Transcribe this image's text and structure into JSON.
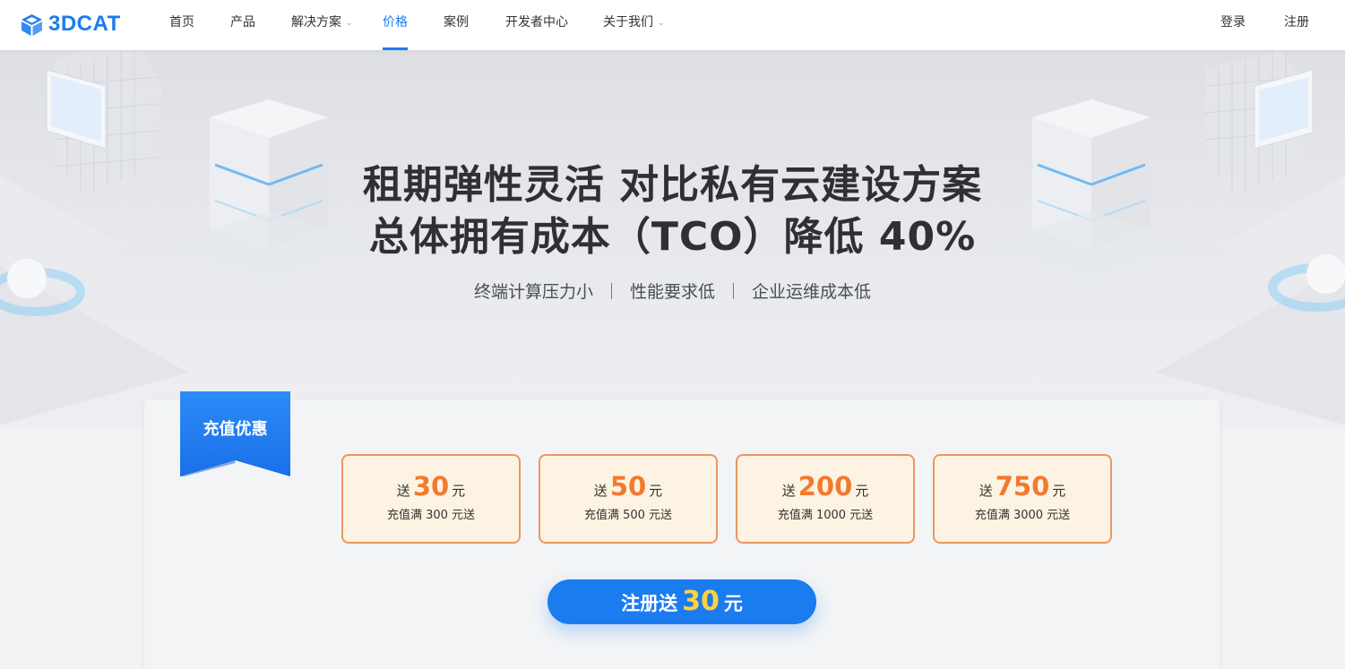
{
  "brand": {
    "name": "3DCAT"
  },
  "nav": {
    "items": [
      {
        "label": "首页"
      },
      {
        "label": "产品"
      },
      {
        "label": "解决方案"
      },
      {
        "label": "价格"
      },
      {
        "label": "案例"
      },
      {
        "label": "开发者中心"
      },
      {
        "label": "关于我们"
      }
    ],
    "active": "价格",
    "login": "登录",
    "register": "注册"
  },
  "hero": {
    "title_line1": "租期弹性灵活 对比私有云建设方案",
    "title_line2": "总体拥有成本（TCO）降低 40%",
    "features": [
      "终端计算压力小",
      "性能要求低",
      "企业运维成本低"
    ]
  },
  "promo": {
    "ribbon": "充值优惠",
    "tiers": [
      {
        "prefix": "送",
        "amount": "30",
        "unit": "元",
        "condition": "充值满 300 元送"
      },
      {
        "prefix": "送",
        "amount": "50",
        "unit": "元",
        "condition": "充值满 500 元送"
      },
      {
        "prefix": "送",
        "amount": "200",
        "unit": "元",
        "condition": "充值满 1000 元送"
      },
      {
        "prefix": "送",
        "amount": "750",
        "unit": "元",
        "condition": "充值满 3000 元送"
      }
    ],
    "cta": {
      "prefix": "注册送",
      "amount": "30",
      "unit": "元"
    }
  },
  "colors": {
    "brand_blue": "#1b7cf0",
    "amount_orange": "#f27a2e",
    "tier_border": "#eb9660",
    "tier_bg": "#fdf3e2",
    "cta_highlight": "#ffd23a"
  }
}
